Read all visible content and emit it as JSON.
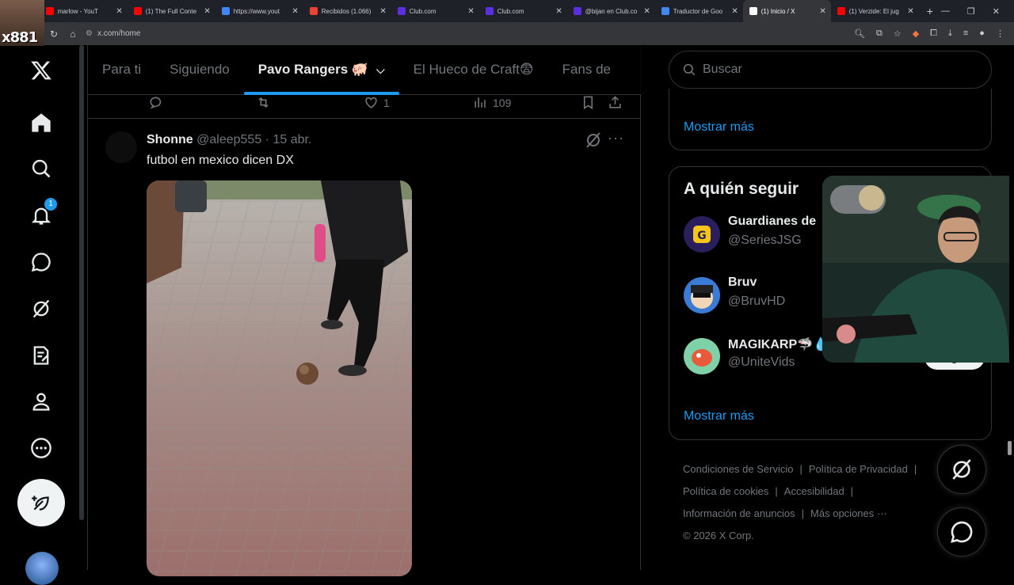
{
  "browser": {
    "tabs": [
      {
        "title": "marlow - YouT",
        "favicon_color": "#ff0000"
      },
      {
        "title": "(1) The Full Conte",
        "favicon_color": "#ff0000"
      },
      {
        "title": "https://www.yout",
        "favicon_color": "#4285f4"
      },
      {
        "title": "Recibidos (1.066)",
        "favicon_color": "#ea4335"
      },
      {
        "title": "Club.com",
        "favicon_color": "#5b2ee0"
      },
      {
        "title": "Club.com",
        "favicon_color": "#5b2ee0"
      },
      {
        "title": "@bijan en Club.co",
        "favicon_color": "#5b2ee0"
      },
      {
        "title": "Traductor de Goo",
        "favicon_color": "#4285f4"
      },
      {
        "title": "(1) Inicio / X",
        "favicon_color": "#ffffff",
        "active": true
      },
      {
        "title": "(1) Verzide: El jug",
        "favicon_color": "#ff0000"
      }
    ],
    "url": "x.com/home",
    "overlay_logo": "x881"
  },
  "nav": {
    "notifications_badge": "1",
    "items": [
      "x-logo",
      "home",
      "explore",
      "notifications",
      "messages",
      "grok",
      "lists",
      "profile",
      "more"
    ]
  },
  "feed_tabs": [
    {
      "label": "Para ti"
    },
    {
      "label": "Siguiendo"
    },
    {
      "label": "Pavo Rangers 🐖",
      "active": true
    },
    {
      "label": "El Hueco de Craft😨"
    },
    {
      "label": "Fans de"
    }
  ],
  "prev_tweet_actions": {
    "likes": "1",
    "views": "109"
  },
  "tweet": {
    "name": "Shonne",
    "handle": "@aleep555",
    "date": "· 15 abr.",
    "text": "futbol en mexico dicen DX"
  },
  "sidebar": {
    "search_placeholder": "Buscar",
    "show_more": "Mostrar más",
    "who_to_follow": {
      "title": "A quién seguir",
      "accounts": [
        {
          "name": "Guardianes de",
          "handle": "@SeriesJSG",
          "avatar_color": "#2a1f5c"
        },
        {
          "name": "Bruv",
          "handle": "@BruvHD",
          "avatar_color": "#3a7bd5"
        },
        {
          "name": "MAGIKARP🦈💧",
          "handle": "@UniteVids",
          "avatar_color": "#7fd1a8",
          "button": "Seguir"
        }
      ],
      "show_more": "Mostrar más"
    },
    "footer": {
      "links": [
        "Condiciones de Servicio",
        "Política de Privacidad",
        "Política de cookies",
        "Accesibilidad",
        "Información de anuncios",
        "Más opciones ···"
      ],
      "copyright": "© 2026 X Corp."
    }
  },
  "colors": {
    "accent": "#1d9bf0",
    "background": "#000000",
    "border": "#2f3336",
    "muted": "#71767b"
  }
}
